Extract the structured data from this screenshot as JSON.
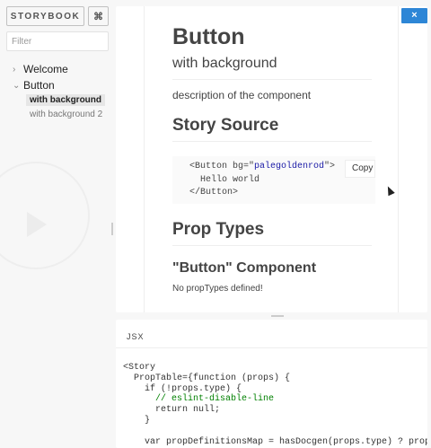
{
  "sidebar": {
    "title_button": "STORYBOOK",
    "shortcut_button": "⌘",
    "filter_placeholder": "Filter",
    "tree": [
      {
        "label": "Welcome",
        "chevron": "›"
      },
      {
        "label": "Button",
        "chevron": "⌄"
      }
    ],
    "stories": [
      {
        "label": "with background",
        "selected": true
      },
      {
        "label": "with background 2",
        "selected": false
      }
    ]
  },
  "preview": {
    "close_label": "×",
    "title": "Button",
    "subtitle": "with background",
    "description": "description of the component",
    "story_source_heading": "Story Source",
    "source_line1_open": "<Button bg=\"",
    "source_line1_value": "palegoldenrod",
    "source_line1_close": "\">",
    "source_line2": "  Hello world",
    "source_line3": "</Button>",
    "copy_label": "Copy",
    "prop_types_heading": "Prop Types",
    "component_heading": "\"Button\" Component",
    "no_props": "No propTypes defined!"
  },
  "panel": {
    "tab_label": "JSX",
    "code_lines": [
      "<Story",
      "  PropTable={function (props) {",
      "    if (!props.type) {",
      "      // eslint-disable-line",
      "      return null;",
      "    }",
      "",
      "    var propDefinitionsMap = hasDocgen(props.type) ? propr"
    ]
  },
  "colors": {
    "accent": "#2d86d6",
    "background": "#f7f7f7"
  }
}
